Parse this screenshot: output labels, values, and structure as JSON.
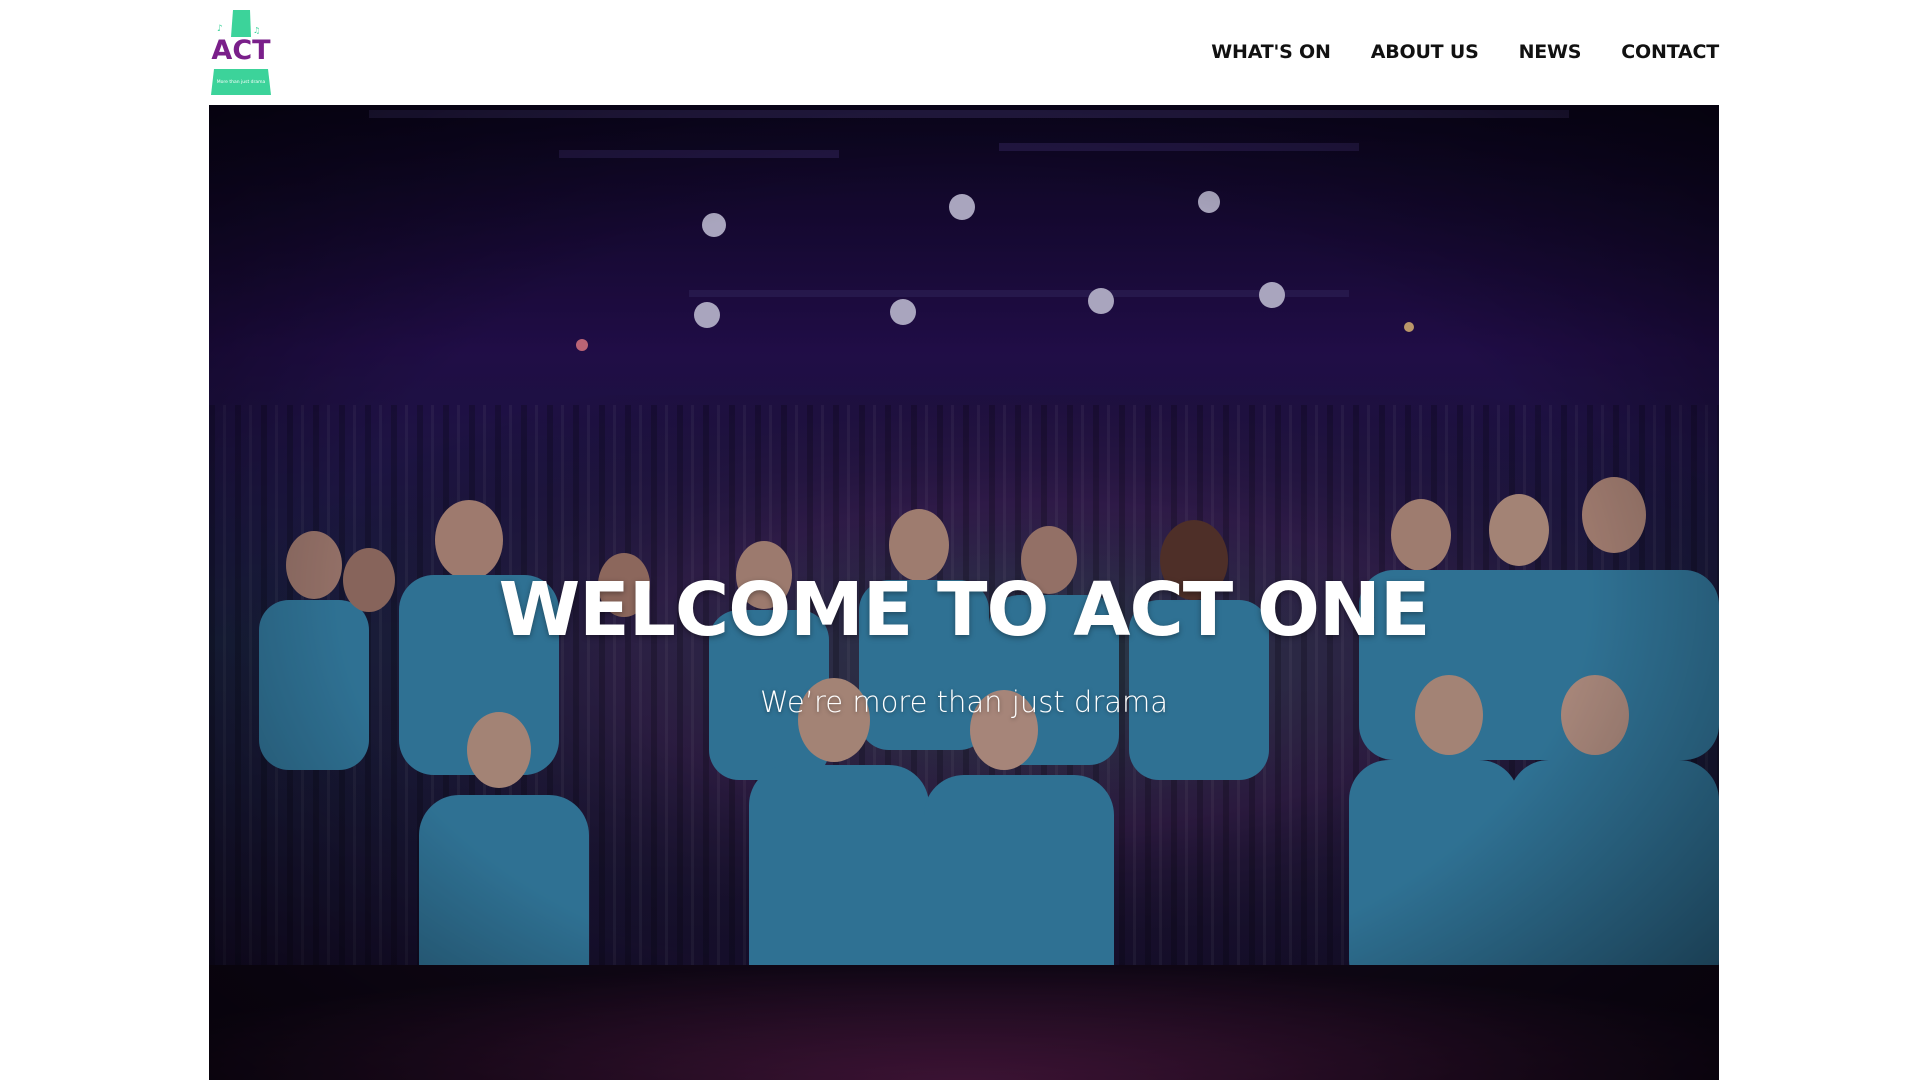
{
  "colors": {
    "brand_purple": "#7a1f8a",
    "brand_green": "#3cd39a",
    "nav_text": "#111111",
    "hero_text": "#ffffff",
    "shirt_blue": "#3f9cc4",
    "stage_purple": "#2a1159"
  },
  "header": {
    "logo": {
      "icon": "act-one-logo",
      "wordmark": "ACT",
      "tagline": "More than just drama"
    },
    "nav": [
      {
        "label": "WHAT'S ON"
      },
      {
        "label": "ABOUT US"
      },
      {
        "label": "NEWS"
      },
      {
        "label": "CONTACT"
      }
    ]
  },
  "hero": {
    "title": "WELCOME TO ACT ONE",
    "subtitle": "We’re more than just drama",
    "image": "group-of-performers-on-stage-photo"
  }
}
